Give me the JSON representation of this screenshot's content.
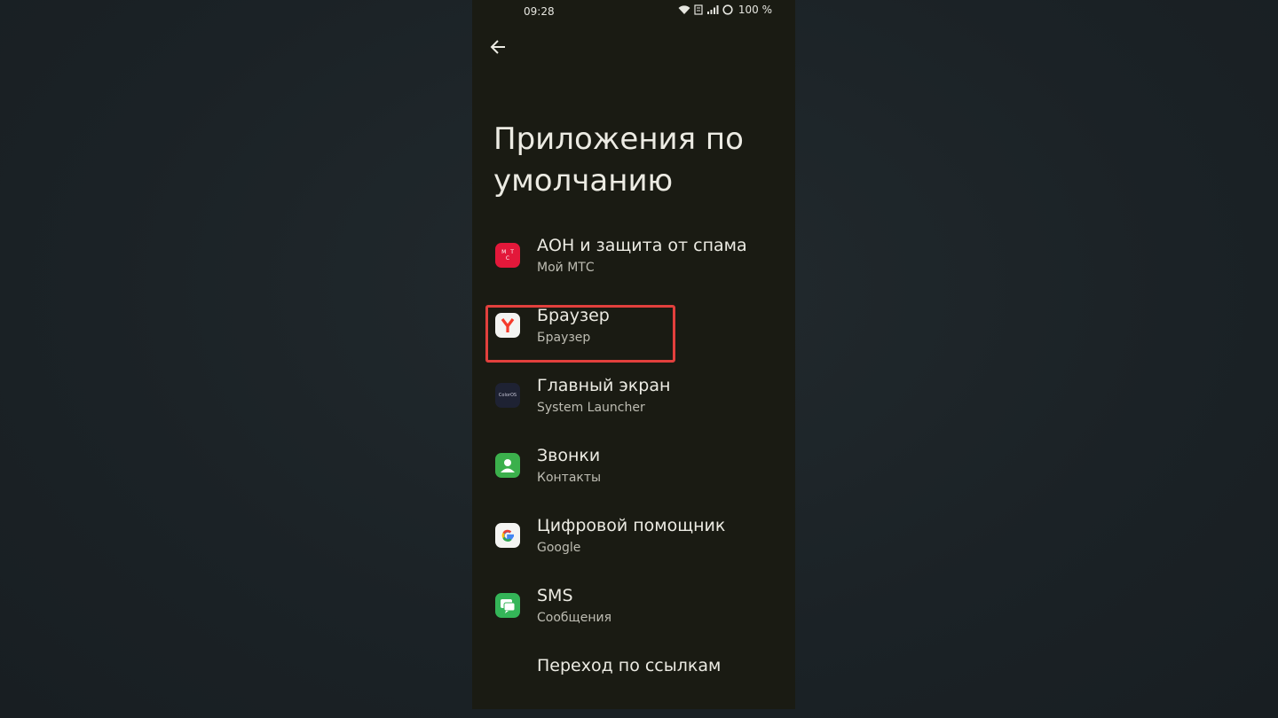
{
  "status_bar": {
    "time": "09:28",
    "battery": "100 %"
  },
  "header": {
    "back_icon": "arrow-left-icon",
    "title": "Приложения по умолчанию"
  },
  "items": [
    {
      "title": "АОН и защита от спама",
      "subtitle": "Мой МТС",
      "icon": "mts-app-icon",
      "icon_text": "М Т С"
    },
    {
      "title": "Браузер",
      "subtitle": "Браузер",
      "icon": "yandex-browser-icon",
      "highlighted": true
    },
    {
      "title": "Главный экран",
      "subtitle": "System Launcher",
      "icon": "coloros-launcher-icon",
      "icon_text": "ColorOS"
    },
    {
      "title": "Звонки",
      "subtitle": "Контакты",
      "icon": "contacts-icon"
    },
    {
      "title": "Цифровой помощник",
      "subtitle": "Google",
      "icon": "google-icon"
    },
    {
      "title": "SMS",
      "subtitle": "Сообщения",
      "icon": "messages-icon"
    },
    {
      "title": "Переход по ссылкам"
    }
  ],
  "colors": {
    "screen_bg": "#1a1b13",
    "text_primary": "#ecebe3",
    "text_secondary": "#bdbcb2",
    "highlight_border": "#e2403d"
  }
}
